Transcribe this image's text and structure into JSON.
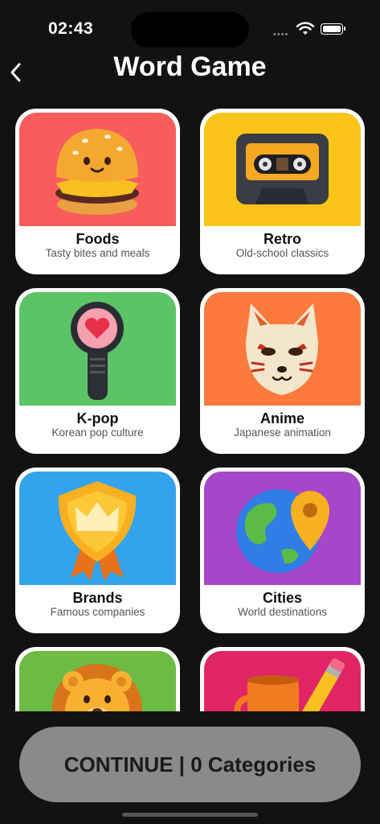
{
  "status_bar": {
    "time": "02:43",
    "dots": "••••"
  },
  "header": {
    "title": "Word Game"
  },
  "categories": [
    {
      "name": "Foods",
      "desc": "Tasty bites and meals",
      "icon": "burger-icon",
      "color": "#f85c5c"
    },
    {
      "name": "Retro",
      "desc": "Old-school classics",
      "icon": "cassette-icon",
      "color": "#fbc418"
    },
    {
      "name": "K-pop",
      "desc": "Korean pop culture",
      "icon": "lightstick-icon",
      "color": "#5cc466"
    },
    {
      "name": "Anime",
      "desc": "Japanese animation",
      "icon": "fox-mask-icon",
      "color": "#fb7a3c"
    },
    {
      "name": "Brands",
      "desc": "Famous companies",
      "icon": "crown-badge-icon",
      "color": "#34a3ee"
    },
    {
      "name": "Cities",
      "desc": "World destinations",
      "icon": "globe-pin-icon",
      "color": "#a646c8"
    },
    {
      "name": "",
      "desc": "",
      "icon": "lion-icon",
      "color": "#6cbb44"
    },
    {
      "name": "",
      "desc": "",
      "icon": "mug-pencil-icon",
      "color": "#e02466"
    }
  ],
  "footer": {
    "continue_label": "CONTINUE | 0 Categories"
  }
}
